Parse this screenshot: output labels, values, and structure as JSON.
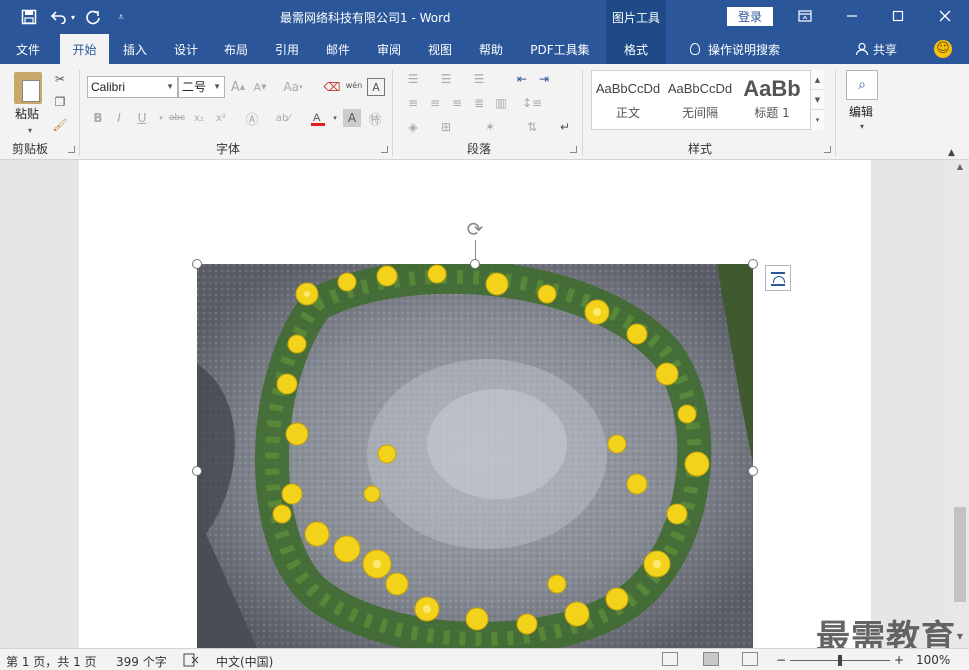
{
  "titlebar": {
    "title": "最需网络科技有限公司1  -  Word",
    "context_tools": "图片工具",
    "login": "登录",
    "icons": [
      "save-icon",
      "undo-icon",
      "redo-icon",
      "customize-icon",
      "ribbon-display-icon",
      "minimize-icon",
      "maximize-icon",
      "close-icon"
    ]
  },
  "tabs": [
    "文件",
    "开始",
    "插入",
    "设计",
    "布局",
    "引用",
    "邮件",
    "审阅",
    "视图",
    "帮助",
    "PDF工具集",
    "格式"
  ],
  "tell_me": "操作说明搜索",
  "share": "共享",
  "ribbon": {
    "clipboard": {
      "paste": "粘贴",
      "label": "剪贴板"
    },
    "font": {
      "name": "Calibri",
      "size": "二号",
      "label": "字体",
      "change_case": "Aa",
      "phonetic_char": "wén"
    },
    "paragraph": {
      "label": "段落"
    },
    "styles": {
      "label": "样式",
      "items": [
        {
          "preview": "AaBbCcDd",
          "name": "正文"
        },
        {
          "preview": "AaBbCcDd",
          "name": "无间隔"
        },
        {
          "preview": "AaBb",
          "name": "标题 1"
        }
      ]
    },
    "editing": {
      "label": "编辑"
    }
  },
  "status": {
    "page": "第 1 页，共 1 页",
    "words": "399 个字",
    "language": "中文(中国)",
    "zoom": "100%",
    "zoom_minus": "−",
    "zoom_plus": "+",
    "zoom_level": 1.0
  },
  "watermark": "最需教育",
  "colors": {
    "accent": "#2b579a",
    "font_color_red": "#e02020"
  }
}
